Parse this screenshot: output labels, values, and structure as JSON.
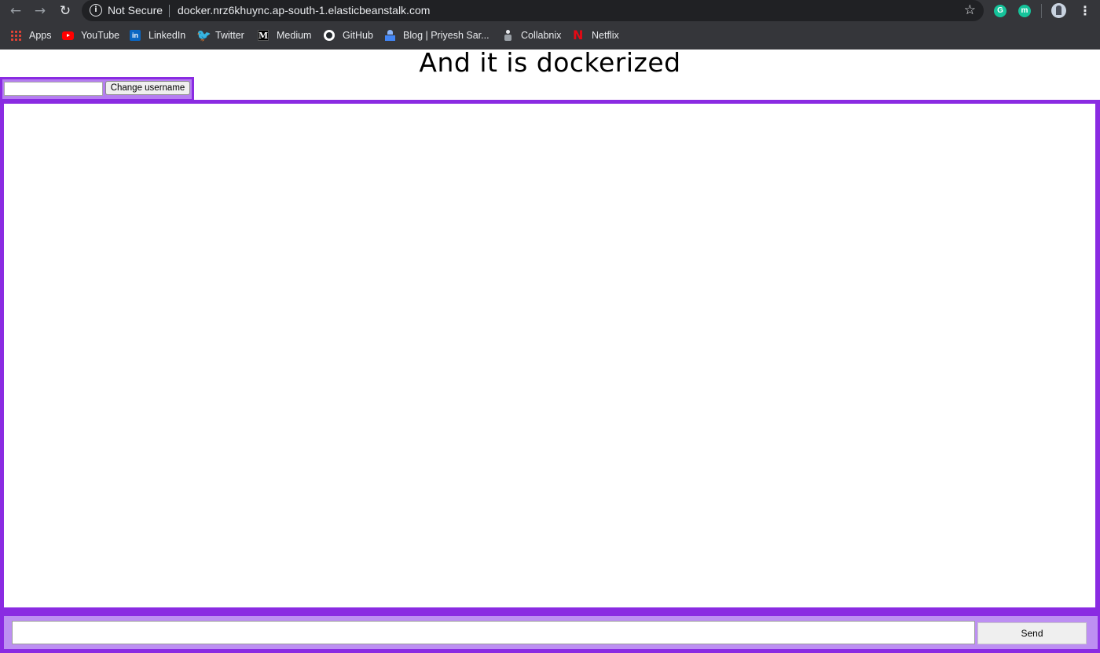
{
  "browser": {
    "security_label": "Not Secure",
    "url": "docker.nrz6khuync.ap-south-1.elasticbeanstalk.com",
    "bookmarks": [
      {
        "label": "Apps",
        "icon": "apps-grid-icon"
      },
      {
        "label": "YouTube",
        "icon": "youtube-icon"
      },
      {
        "label": "LinkedIn",
        "icon": "linkedin-icon"
      },
      {
        "label": "Twitter",
        "icon": "twitter-icon"
      },
      {
        "label": "Medium",
        "icon": "medium-icon"
      },
      {
        "label": "GitHub",
        "icon": "github-icon"
      },
      {
        "label": "Blog | Priyesh Sar...",
        "icon": "blog-icon"
      },
      {
        "label": "Collabnix",
        "icon": "collabnix-icon"
      },
      {
        "label": "Netflix",
        "icon": "netflix-icon"
      }
    ],
    "icons": {
      "back": "←",
      "forward": "→",
      "reload": "↻",
      "info": "i",
      "star": "☆",
      "menu": "⋮",
      "linkedin": "in",
      "twitter": "🐦",
      "medium": "M",
      "netflix": "N",
      "ext_m": "m"
    }
  },
  "page": {
    "title": "And it is dockerized",
    "username_value": "",
    "change_username_label": "Change username",
    "message_value": "",
    "send_label": "Send",
    "accent_color": "#8a2be2"
  }
}
